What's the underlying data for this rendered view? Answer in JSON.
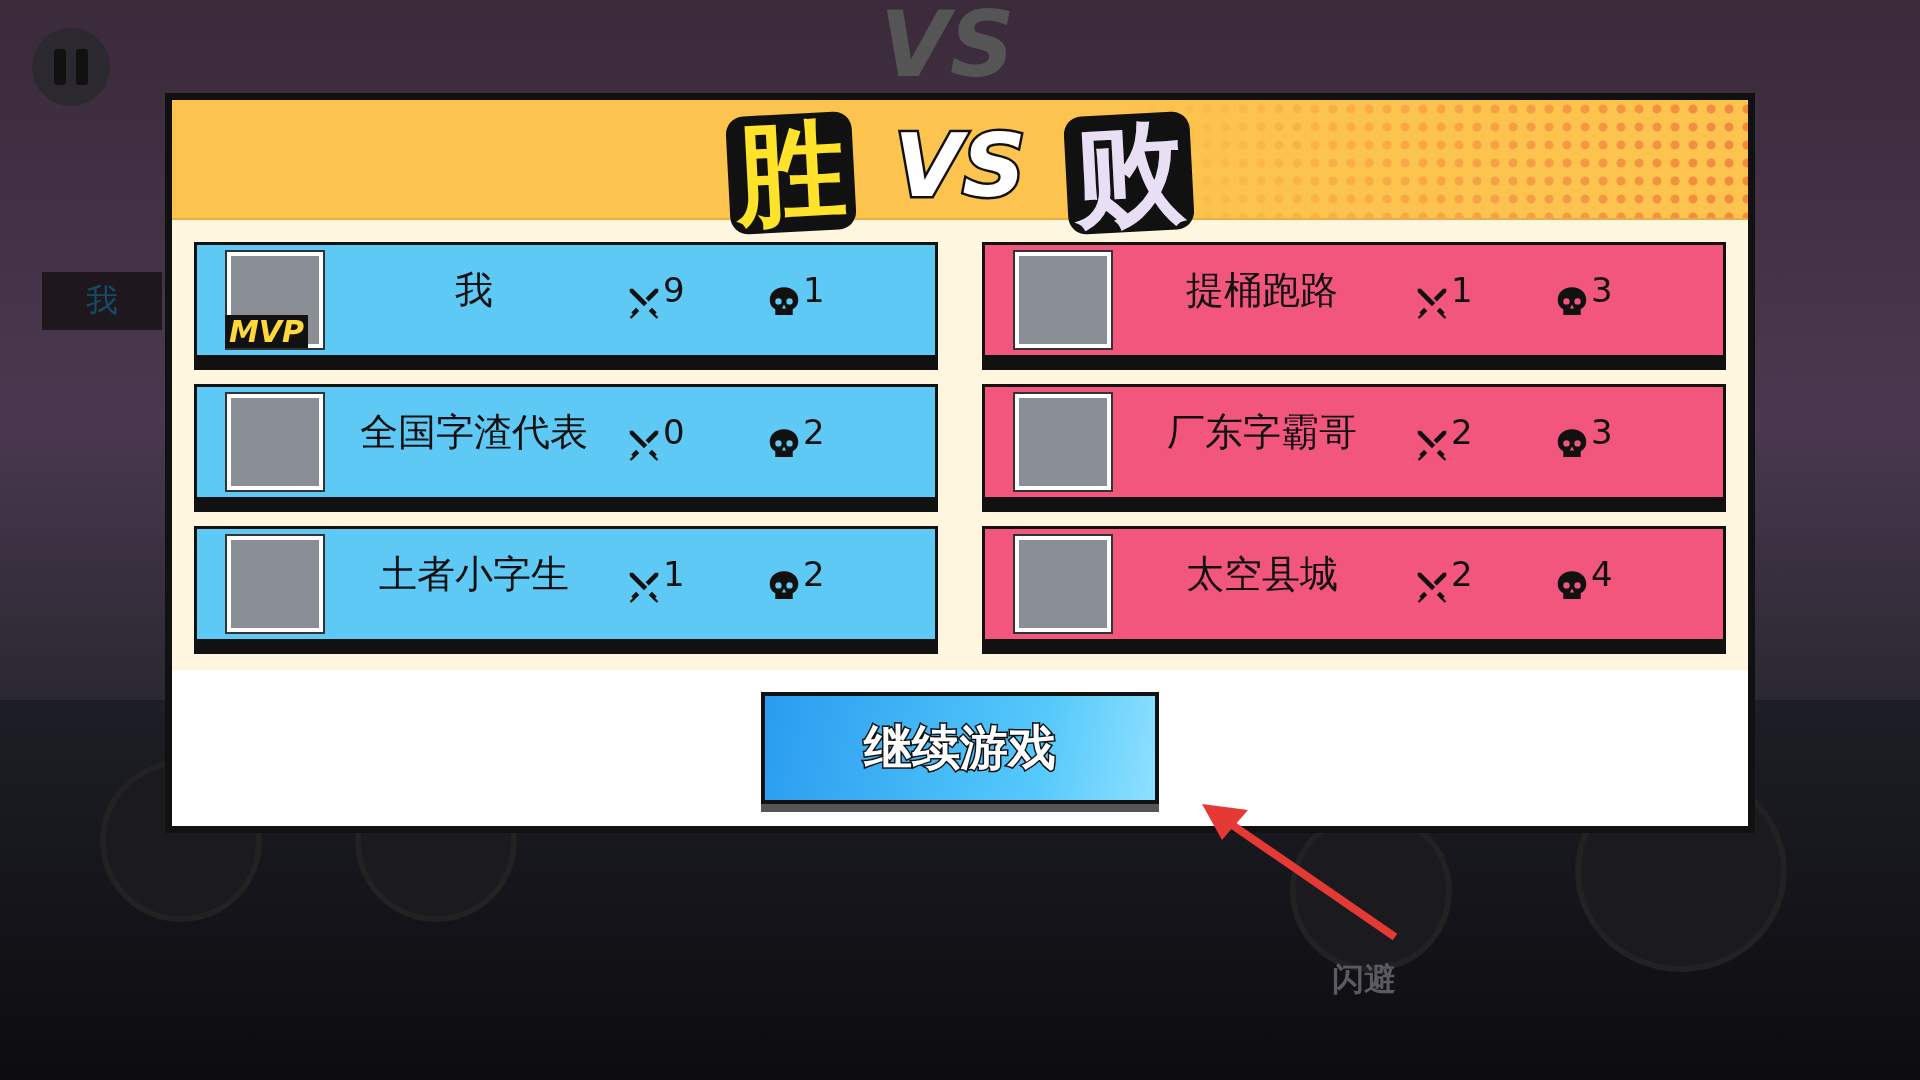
{
  "background": {
    "vs_mark": "VS",
    "player_tag": "我",
    "dodge_label": "闪避"
  },
  "header": {
    "win": "胜",
    "vs": "VS",
    "lose": "败"
  },
  "teams": [
    {
      "color": "#5fc9f6",
      "players": [
        {
          "name": "我",
          "kills": "9",
          "deaths": "1",
          "badge": "MVP"
        },
        {
          "name": "全国字渣代表",
          "kills": "0",
          "deaths": "2"
        },
        {
          "name": "土者小字生",
          "kills": "1",
          "deaths": "2"
        }
      ]
    },
    {
      "color": "#f2567c",
      "players": [
        {
          "name": "提桶跑路",
          "kills": "1",
          "deaths": "3"
        },
        {
          "name": "厂东字霸哥",
          "kills": "2",
          "deaths": "3"
        },
        {
          "name": "太空县城",
          "kills": "2",
          "deaths": "4"
        }
      ]
    }
  ],
  "continue_button": "继续游戏"
}
